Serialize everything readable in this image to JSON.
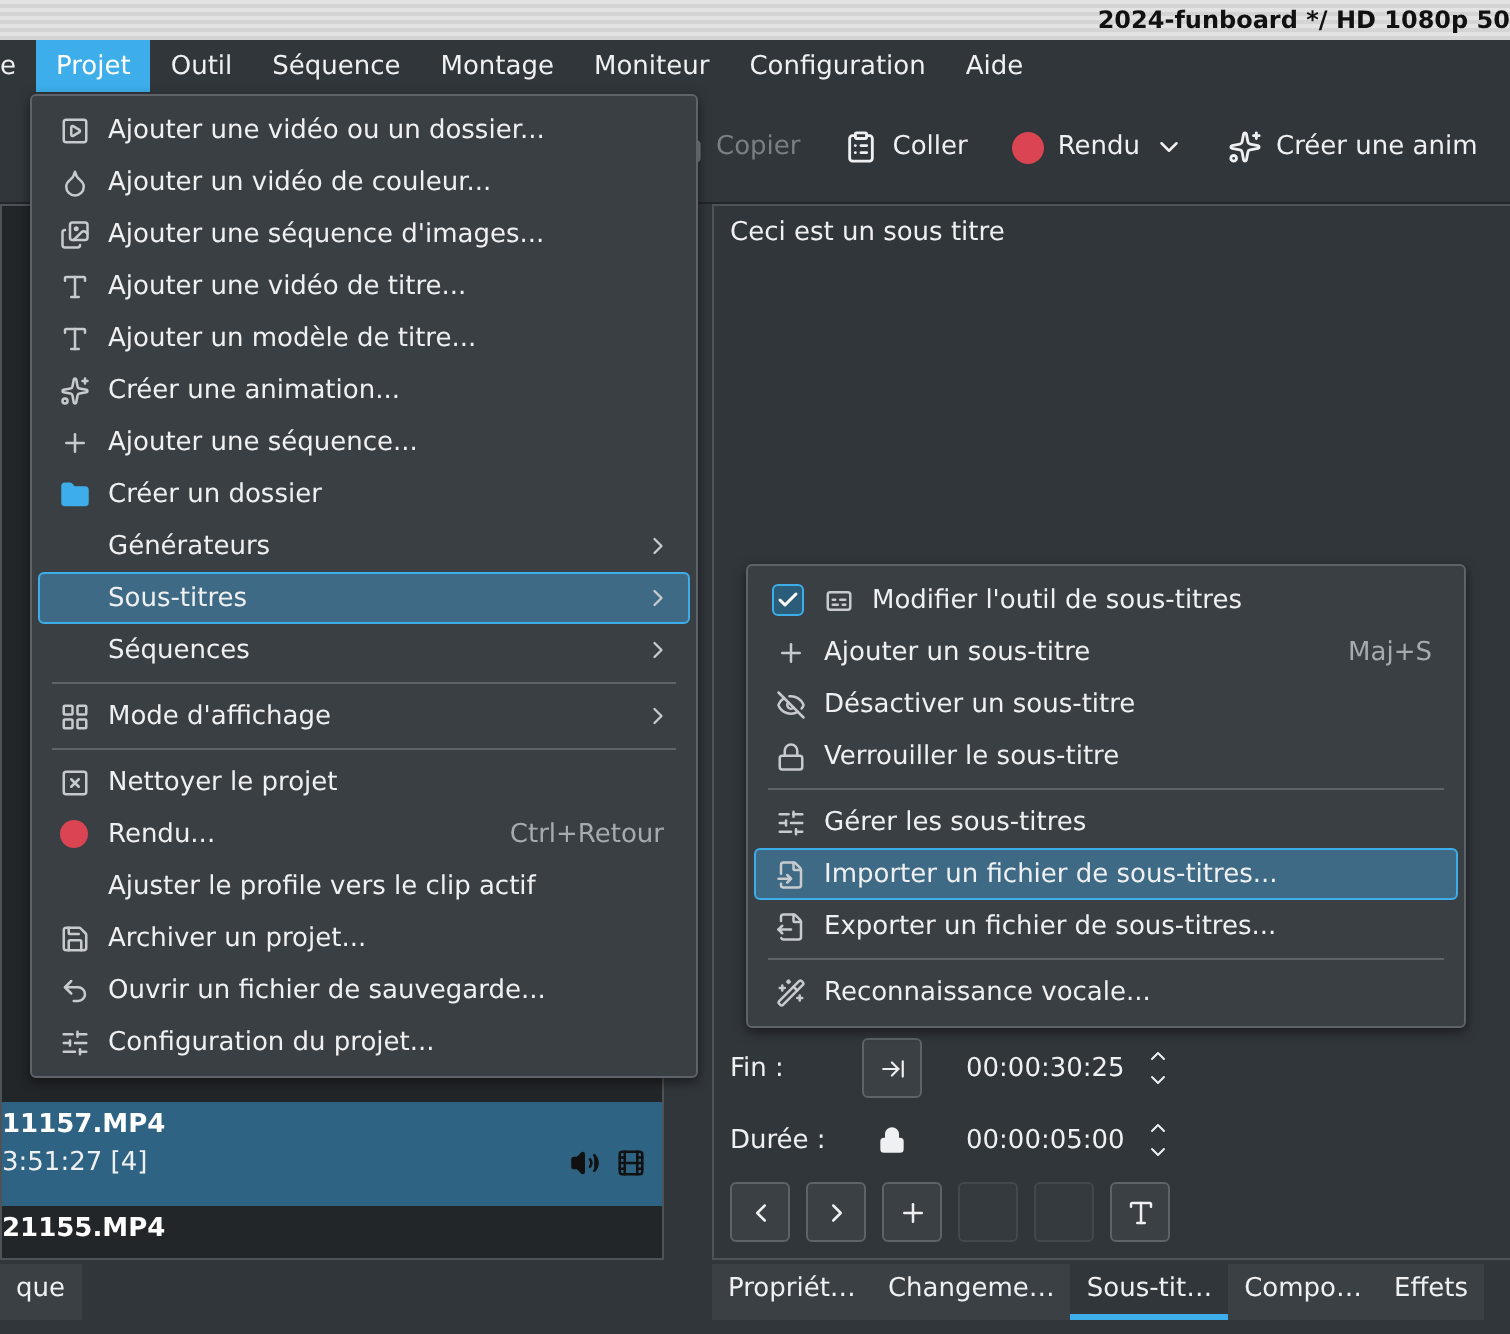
{
  "window": {
    "title": "2024-funboard */ HD 1080p 50"
  },
  "menubar": [
    {
      "label": "e",
      "selected": false
    },
    {
      "label": "Projet",
      "selected": true
    },
    {
      "label": "Outil",
      "selected": false
    },
    {
      "label": "Séquence",
      "selected": false
    },
    {
      "label": "Montage",
      "selected": false
    },
    {
      "label": "Moniteur",
      "selected": false
    },
    {
      "label": "Configuration",
      "selected": false
    },
    {
      "label": "Aide",
      "selected": false
    }
  ],
  "toolbar": [
    {
      "label": "Copier",
      "disabled": true
    },
    {
      "label": "Coller",
      "disabled": false
    },
    {
      "label": "Rendu",
      "disabled": false
    },
    {
      "label": "Créer une anim",
      "disabled": false
    }
  ],
  "clip_list": {
    "rows": [
      {
        "name": "11157.MP4",
        "info": "3:51:27 [4]",
        "selected": true
      },
      {
        "name": "21155.MP4",
        "selected": false
      }
    ]
  },
  "left_tab": {
    "label": "que"
  },
  "subtitle_editor": {
    "text": "Ceci est un sous titre",
    "fields": [
      {
        "kind": "button",
        "label": "Fin :",
        "value": "00:00:30:25"
      },
      {
        "kind": "lock",
        "label": "Durée :",
        "value": "00:00:05:00"
      }
    ],
    "buttons": [
      {
        "disabled": false
      },
      {
        "disabled": false
      },
      {
        "disabled": false
      },
      {
        "disabled": true
      },
      {
        "disabled": true
      },
      {
        "disabled": false
      }
    ]
  },
  "bottom_tabs": [
    {
      "label": "Propriét…",
      "selected": false
    },
    {
      "label": "Changeme…",
      "selected": false
    },
    {
      "label": "Sous-tit…",
      "selected": true
    },
    {
      "label": "Compo…",
      "selected": false
    },
    {
      "label": "Effets",
      "selected": false
    }
  ],
  "project_menu": {
    "items": [
      {
        "kind": "item",
        "label": "Ajouter une vidéo ou un dossier...",
        "selected": false
      },
      {
        "kind": "item",
        "label": "Ajouter un vidéo de couleur...",
        "selected": false
      },
      {
        "kind": "item",
        "label": "Ajouter une séquence d'images...",
        "selected": false
      },
      {
        "kind": "item",
        "label": "Ajouter une vidéo de titre...",
        "selected": false
      },
      {
        "kind": "item",
        "label": "Ajouter un modèle de titre...",
        "selected": false
      },
      {
        "kind": "item",
        "label": "Créer une animation...",
        "selected": false
      },
      {
        "kind": "item",
        "label": "Ajouter une séquence...",
        "selected": false
      },
      {
        "kind": "item",
        "label": "Créer un dossier",
        "selected": false
      },
      {
        "kind": "submenu",
        "label": "Générateurs",
        "selected": false
      },
      {
        "kind": "submenu",
        "label": "Sous-titres",
        "selected": true
      },
      {
        "kind": "submenu",
        "label": "Séquences",
        "selected": false
      },
      {
        "kind": "separator"
      },
      {
        "kind": "submenu",
        "label": "Mode d'affichage",
        "selected": false
      },
      {
        "kind": "separator"
      },
      {
        "kind": "item",
        "label": "Nettoyer le projet",
        "selected": false
      },
      {
        "kind": "item",
        "label": "Rendu...",
        "shortcut": "Ctrl+Retour",
        "selected": false
      },
      {
        "kind": "item",
        "label": "Ajuster le profile vers le clip actif",
        "selected": false
      },
      {
        "kind": "item",
        "label": "Archiver un projet...",
        "selected": false
      },
      {
        "kind": "item",
        "label": "Ouvrir un fichier de sauvegarde...",
        "selected": false
      },
      {
        "kind": "item",
        "label": "Configuration du projet...",
        "selected": false
      }
    ]
  },
  "subtitles_submenu": {
    "items": [
      {
        "kind": "item",
        "label": "Modifier l'outil de sous-titres",
        "checked": true,
        "selected": false
      },
      {
        "kind": "item",
        "label": "Ajouter un sous-titre",
        "shortcut": "Maj+S",
        "selected": false
      },
      {
        "kind": "item",
        "label": "Désactiver un sous-titre",
        "selected": false
      },
      {
        "kind": "item",
        "label": "Verrouiller le sous-titre",
        "selected": false
      },
      {
        "kind": "separator"
      },
      {
        "kind": "item",
        "label": "Gérer les sous-titres",
        "selected": false
      },
      {
        "kind": "item",
        "label": "Importer un fichier de sous-titres...",
        "selected": true
      },
      {
        "kind": "item",
        "label": "Exporter un fichier de sous-titres...",
        "selected": false
      },
      {
        "kind": "separator"
      },
      {
        "kind": "item",
        "label": "Reconnaissance vocale...",
        "selected": false
      }
    ]
  }
}
